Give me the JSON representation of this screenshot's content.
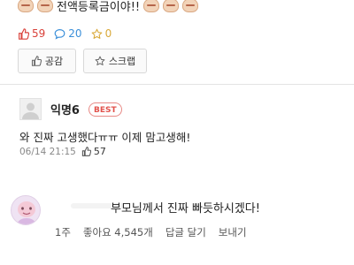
{
  "post": {
    "partial_text": "전액등록금이야!!",
    "stats": {
      "likes": "59",
      "comments": "20",
      "scraps": "0"
    },
    "buttons": {
      "like": "공감",
      "scrap": "스크랩"
    }
  },
  "comment": {
    "author": "익명6",
    "badge": "BEST",
    "text": "와 진짜 고생했다ㅠㅠ 이제 맘고생해!",
    "timestamp": "06/14 21:15",
    "likes": "57"
  },
  "reply": {
    "text": "부모님께서 진짜 빠듯하시겠다!",
    "time_ago": "1주",
    "likes_label": "좋아요 4,545개",
    "reply_label": "답글 달기",
    "send_label": "보내기"
  },
  "colors": {
    "accent": "#e2524c",
    "comment_count": "#3a8fd9",
    "scrap_count": "#d9a93a"
  },
  "icons": [
    "emoji-face-icon",
    "thumbs-up-icon",
    "speech-bubble-icon",
    "star-icon",
    "default-avatar-icon",
    "profile-avatar-icon"
  ]
}
